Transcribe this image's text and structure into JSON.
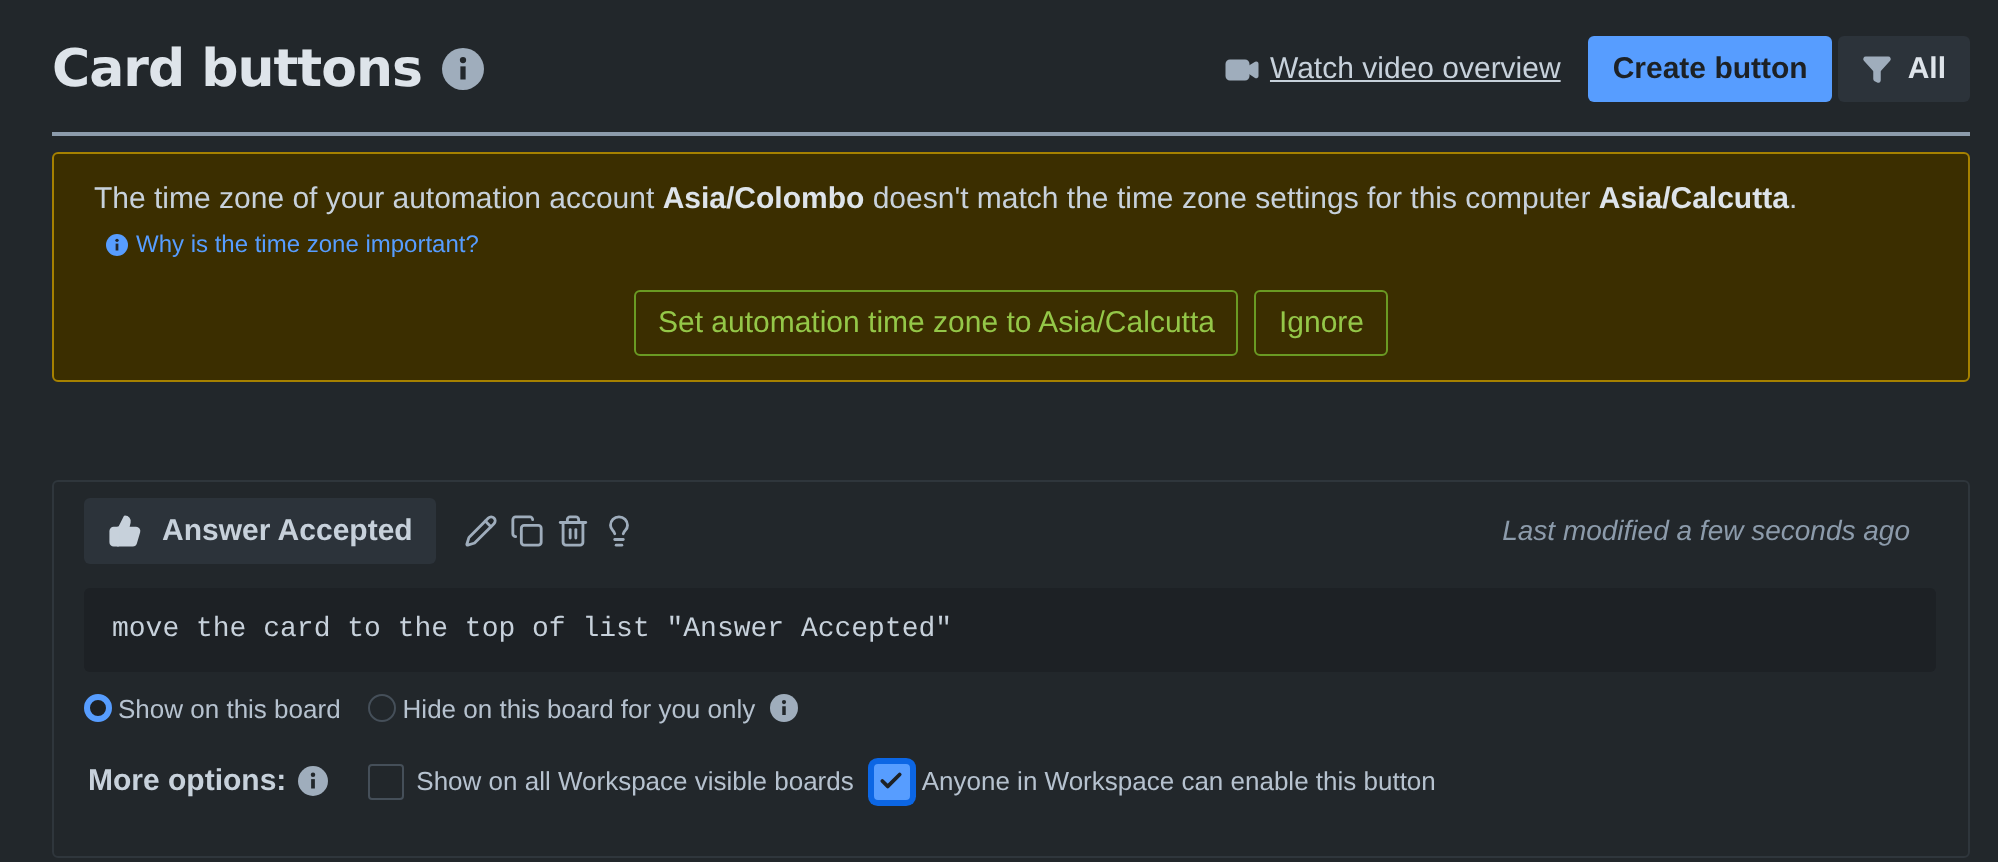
{
  "header": {
    "title": "Card buttons",
    "video_link": "Watch video overview",
    "create_button": "Create button",
    "filter_button": "All"
  },
  "warning": {
    "message": "The time zone of your automation account **Asia/Colombo** doesn't match the time zone settings for this computer **Asia/Calcutta**.",
    "link": "Why is the time zone important?",
    "actions": [
      {
        "label": "Set automation time zone to Asia/Calcutta"
      },
      {
        "label": "Ignore"
      }
    ]
  },
  "card_buttons": [
    {
      "name": "Answer Accepted",
      "last_modified": "Last modified a few seconds ago",
      "command": "move the card to the top of list \"Answer Accepted\"",
      "visibility": [
        {
          "label": "Show on this board",
          "selected": true,
          "info": false
        },
        {
          "label": "Hide on this board for you only",
          "selected": false,
          "info": true
        }
      ],
      "more_options_label": "More options:",
      "options": [
        {
          "label": "Show on all Workspace visible boards",
          "checked": false
        },
        {
          "label": "Anyone in Workspace can enable this button",
          "checked": true
        }
      ]
    }
  ]
}
